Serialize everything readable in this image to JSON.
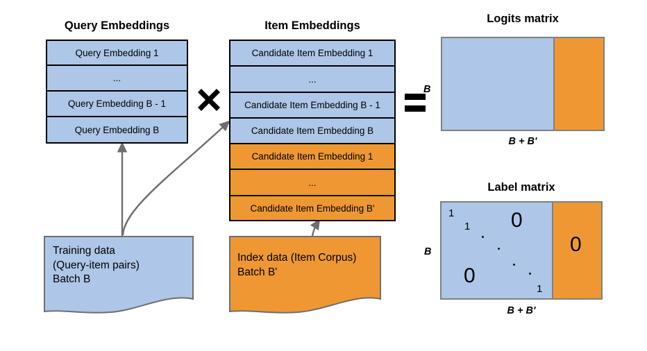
{
  "diagram": {
    "title_query": "Query Embeddings",
    "title_item": "Item Embeddings",
    "title_logits": "Logits matrix",
    "title_label": "Label matrix",
    "operator_multiply": "multiply-x-icon",
    "operator_equals": "equals-icon",
    "colors": {
      "blue": "#aec6e8",
      "orange": "#ef9833",
      "border_dark": "#000000",
      "border_gray": "#808080",
      "arrow": "#6e6e6e"
    }
  },
  "query_embeddings": {
    "rows": [
      {
        "text": "Query Embedding 1",
        "color": "blue"
      },
      {
        "text": "...",
        "color": "blue"
      },
      {
        "text": "Query Embedding B - 1",
        "color": "blue"
      },
      {
        "text": "Query Embedding B",
        "color": "blue"
      }
    ]
  },
  "item_embeddings": {
    "rows": [
      {
        "text": "Candidate Item Embedding 1",
        "color": "blue"
      },
      {
        "text": "...",
        "color": "blue"
      },
      {
        "text": "Candidate Item Embedding B - 1",
        "color": "blue"
      },
      {
        "text": "Candidate Item Embedding B",
        "color": "blue"
      },
      {
        "text": "Candidate Item Embedding 1",
        "color": "orange"
      },
      {
        "text": "...",
        "color": "orange"
      },
      {
        "text": "Candidate Item Embedding B'",
        "color": "orange"
      }
    ]
  },
  "training_data": {
    "line1": "Training data",
    "line2": "(Query-item pairs)",
    "line3": "Batch B"
  },
  "index_data": {
    "line1": "Index data (Item Corpus)",
    "line2": "Batch B'"
  },
  "logits_matrix": {
    "title": "Logits matrix",
    "row_label": "B",
    "col_label": "B + B'"
  },
  "label_matrix": {
    "title": "Label matrix",
    "row_label": "B",
    "col_label": "B + B'",
    "cells": [
      {
        "value": "1",
        "size": "small"
      },
      {
        "value": "1",
        "size": "small"
      },
      {
        "value": "0",
        "size": "big"
      },
      {
        "value": "0",
        "size": "big"
      },
      {
        "value": "1",
        "size": "small"
      },
      {
        "value": "0",
        "size": "big"
      }
    ]
  }
}
